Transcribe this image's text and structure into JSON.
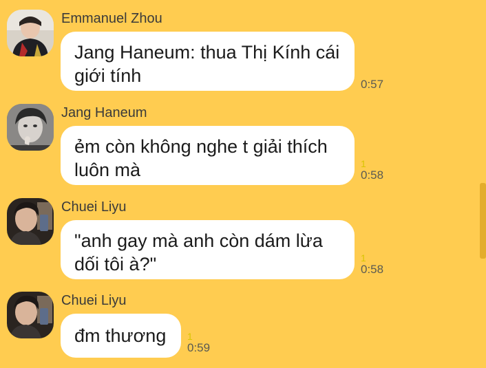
{
  "messages": [
    {
      "sender": "Emmanuel Zhou",
      "lines": [
        "Jang Haneum: thua Thị Kính cái",
        "giới tính"
      ],
      "unread": "",
      "time": "0:57"
    },
    {
      "sender": "Jang Haneum",
      "lines": [
        "ẻm còn không nghe t giải thích",
        "luôn mà"
      ],
      "unread": "1",
      "time": "0:58"
    },
    {
      "sender": "Chuei Liyu",
      "lines": [
        "\"anh gay mà anh còn dám lừa",
        "dối tôi à?\""
      ],
      "unread": "1",
      "time": "0:58"
    },
    {
      "sender": "Chuei Liyu",
      "lines": [
        "đm thương"
      ],
      "unread": "1",
      "time": "0:59"
    }
  ],
  "colors": {
    "background": "#FFCC50",
    "bubble": "#FFFFFF",
    "unread_count": "#D9C400"
  }
}
